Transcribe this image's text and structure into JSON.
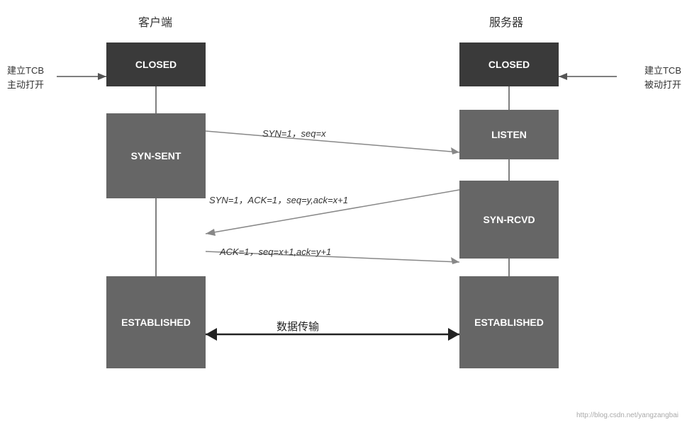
{
  "labels": {
    "client": "客户端",
    "server": "服务器",
    "left_annotation_line1": "建立TCB",
    "left_annotation_line2": "主动打开",
    "right_annotation_line1": "建立TCB",
    "right_annotation_line2": "被动打开"
  },
  "states": {
    "client_closed": "CLOSED",
    "server_closed": "CLOSED",
    "syn_sent": "SYN-SENT",
    "listen": "LISTEN",
    "syn_rcvd": "SYN-RCVD",
    "client_established": "ESTABLISHED",
    "server_established": "ESTABLISHED"
  },
  "arrows": {
    "syn": "SYN=1，seq=x",
    "syn_ack": "SYN=1，ACK=1，seq=y,ack=x+1",
    "ack": "ACK=1，seq=x+1,ack=y+1",
    "data": "数据传输"
  },
  "watermark": "http://blog.csdn.net/yangzangbai"
}
